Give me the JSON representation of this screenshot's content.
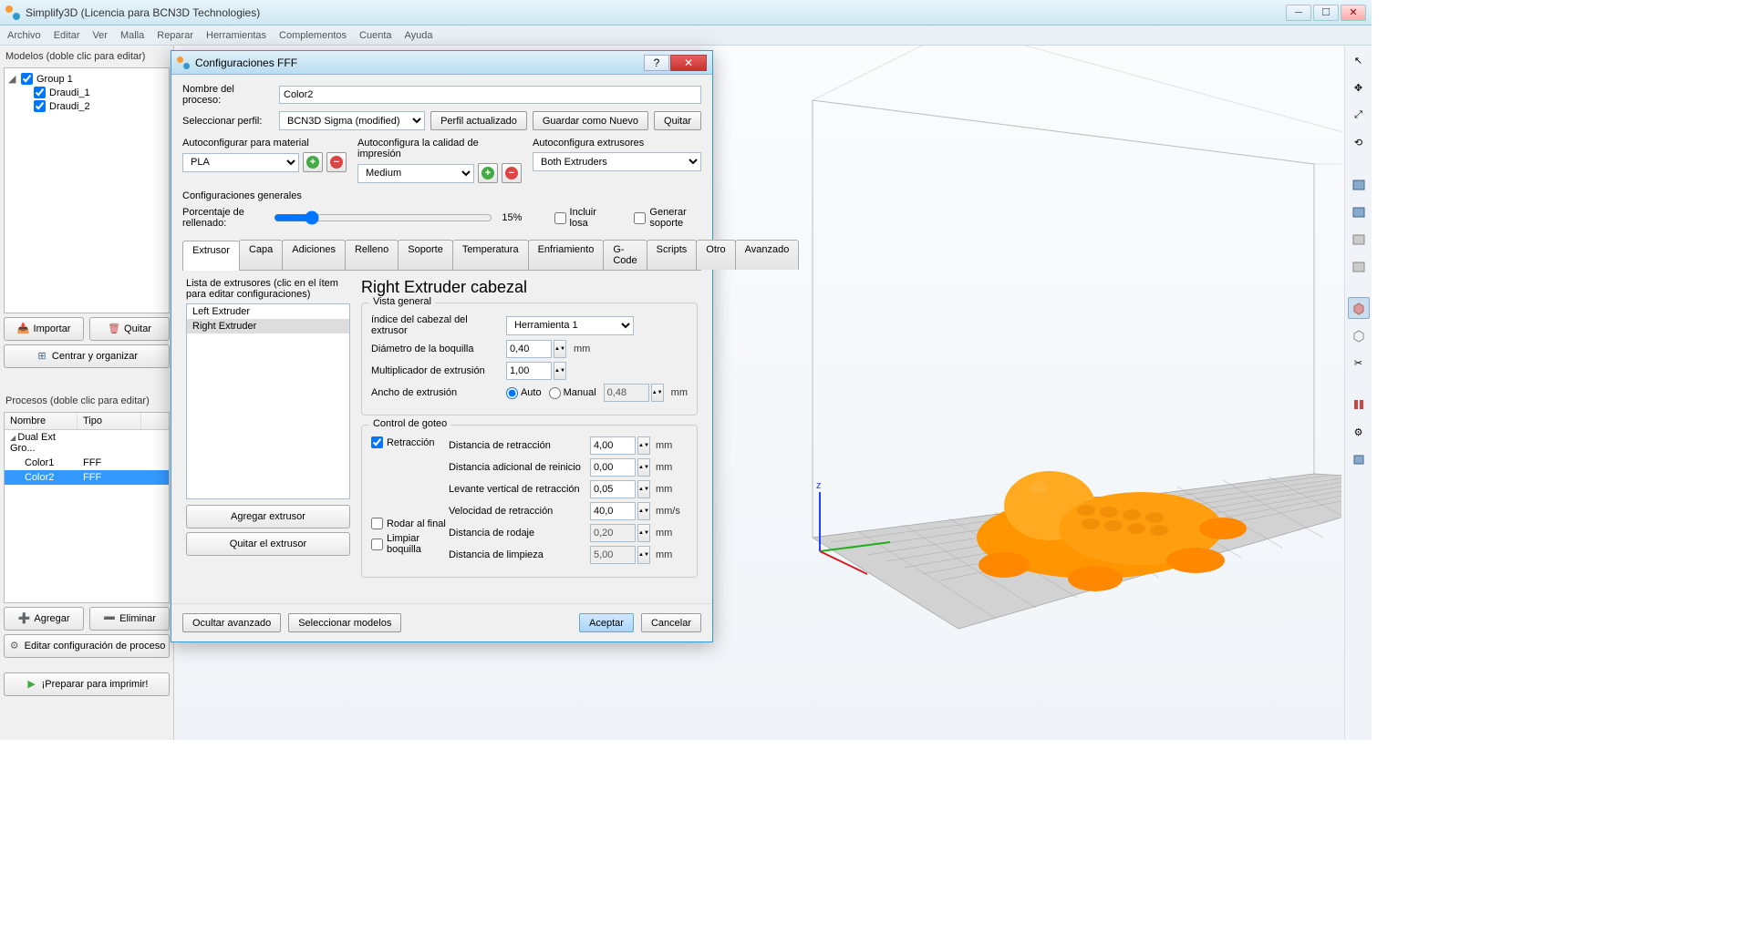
{
  "title": "Simplify3D (Licencia para BCN3D Technologies)",
  "menu": [
    "Archivo",
    "Editar",
    "Ver",
    "Malla",
    "Reparar",
    "Herramientas",
    "Complementos",
    "Cuenta",
    "Ayuda"
  ],
  "models": {
    "title": "Modelos (doble clic para editar)",
    "group": "Group 1",
    "items": [
      "Draudi_1",
      "Draudi_2"
    ],
    "import": "Importar",
    "remove": "Quitar",
    "center": "Centrar y organizar"
  },
  "processes": {
    "title": "Procesos (doble clic para editar)",
    "col_name": "Nombre",
    "col_type": "Tipo",
    "group": "Dual Ext Gro...",
    "rows": [
      {
        "name": "Color1",
        "type": "FFF"
      },
      {
        "name": "Color2",
        "type": "FFF"
      }
    ],
    "add": "Agregar",
    "delete": "Eliminar",
    "edit": "Editar configuración de proceso",
    "prepare": "¡Preparar para imprimir!"
  },
  "dialog": {
    "title": "Configuraciones FFF",
    "process_name_lbl": "Nombre del proceso:",
    "process_name": "Color2",
    "profile_lbl": "Seleccionar perfil:",
    "profile": "BCN3D Sigma (modified)",
    "profile_updated": "Perfil actualizado",
    "save_as_new": "Guardar como Nuevo",
    "remove": "Quitar",
    "auto_mat": "Autoconfigurar para material",
    "auto_qual": "Autoconfigura la calidad de impresión",
    "auto_ext": "Autoconfigura extrusores",
    "material": "PLA",
    "quality": "Medium",
    "extruders_sel": "Both Extruders",
    "general": "Configuraciones generales",
    "infill_lbl": "Porcentaje de rellenado:",
    "infill_pct": "15%",
    "include_raft": "Incluir losa",
    "gen_support": "Generar soporte",
    "tabs": [
      "Extrusor",
      "Capa",
      "Adiciones",
      "Relleno",
      "Soporte",
      "Temperatura",
      "Enfriamiento",
      "G-Code",
      "Scripts",
      "Otro",
      "Avanzado"
    ],
    "ext_list_title": "Lista de extrusores (clic en el ítem para editar configuraciones)",
    "ext_items": [
      "Left Extruder",
      "Right Extruder"
    ],
    "add_ext": "Agregar extrusor",
    "remove_ext": "Quitar el extrusor",
    "ext_heading": "Right Extruder cabezal",
    "overview": "Vista general",
    "tool_idx_lbl": "índice del cabezal del extrusor",
    "tool_idx": "Herramienta 1",
    "nozzle_lbl": "Diámetro de la boquilla",
    "nozzle": "0,40",
    "mult_lbl": "Multiplicador de extrusión",
    "mult": "1,00",
    "width_lbl": "Ancho de extrusión",
    "width_auto": "Auto",
    "width_manual": "Manual",
    "width": "0,48",
    "ooze": "Control de goteo",
    "retraction": "Retracción",
    "ret_dist_lbl": "Distancia de retracción",
    "ret_dist": "4,00",
    "extra_dist_lbl": "Distancia adicional de reinicio",
    "extra_dist": "0,00",
    "vert_lift_lbl": "Levante vertical de retracción",
    "vert_lift": "0,05",
    "ret_speed_lbl": "Velocidad de retracción",
    "ret_speed": "40,0",
    "coast_lbl": "Rodar al final",
    "coast_dist_lbl": "Distancia de rodaje",
    "coast_dist": "0,20",
    "wipe_lbl": "Limpiar boquilla",
    "wipe_dist_lbl": "Distancia de limpieza",
    "wipe_dist": "5,00",
    "mm": "mm",
    "mms": "mm/s",
    "hide_adv": "Ocultar avanzado",
    "sel_models": "Seleccionar modelos",
    "accept": "Aceptar",
    "cancel": "Cancelar"
  }
}
